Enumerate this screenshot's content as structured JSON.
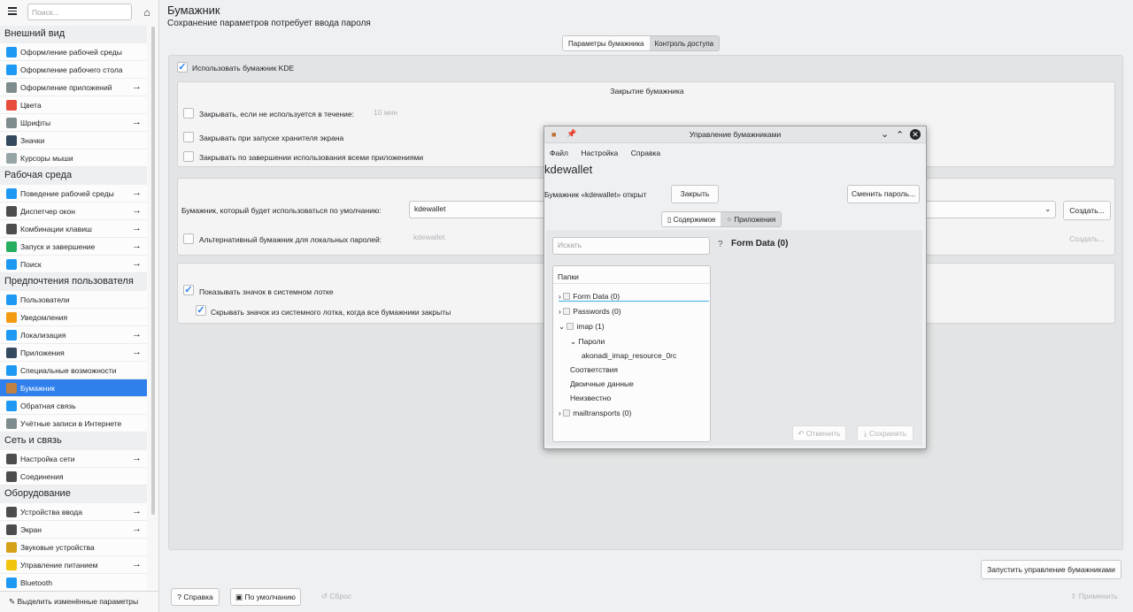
{
  "sidebar": {
    "search_placeholder": "Поиск...",
    "categories": [
      {
        "label": "Внешний вид",
        "items": [
          {
            "label": "Оформление рабочей среды",
            "arrow": false,
            "color": "#1d99f3"
          },
          {
            "label": "Оформление рабочего стола",
            "arrow": false,
            "color": "#1d99f3"
          },
          {
            "label": "Оформление приложений",
            "arrow": true,
            "color": "#7f8c8d"
          },
          {
            "label": "Цвета",
            "arrow": false,
            "color": "#e74c3c"
          },
          {
            "label": "Шрифты",
            "arrow": true,
            "color": "#7f8c8d"
          },
          {
            "label": "Значки",
            "arrow": false,
            "color": "#34495e"
          },
          {
            "label": "Курсоры мыши",
            "arrow": false,
            "color": "#95a5a6"
          }
        ]
      },
      {
        "label": "Рабочая среда",
        "items": [
          {
            "label": "Поведение рабочей среды",
            "arrow": true,
            "color": "#1d99f3"
          },
          {
            "label": "Диспетчер окон",
            "arrow": true,
            "color": "#4d4d4d"
          },
          {
            "label": "Комбинации клавиш",
            "arrow": true,
            "color": "#4d4d4d"
          },
          {
            "label": "Запуск и завершение",
            "arrow": true,
            "color": "#27ae60"
          },
          {
            "label": "Поиск",
            "arrow": true,
            "color": "#1d99f3"
          }
        ]
      },
      {
        "label": "Предпочтения пользователя",
        "items": [
          {
            "label": "Пользователи",
            "arrow": false,
            "color": "#1d99f3"
          },
          {
            "label": "Уведомления",
            "arrow": false,
            "color": "#f39c12"
          },
          {
            "label": "Локализация",
            "arrow": true,
            "color": "#1d99f3"
          },
          {
            "label": "Приложения",
            "arrow": true,
            "color": "#34495e"
          },
          {
            "label": "Специальные возможности",
            "arrow": false,
            "color": "#1d99f3"
          },
          {
            "label": "Бумажник",
            "arrow": false,
            "color": "#c08040",
            "selected": true
          },
          {
            "label": "Обратная связь",
            "arrow": false,
            "color": "#1d99f3"
          },
          {
            "label": "Учётные записи в Интернете",
            "arrow": false,
            "color": "#7f8c8d"
          }
        ]
      },
      {
        "label": "Сеть и связь",
        "items": [
          {
            "label": "Настройка сети",
            "arrow": true,
            "color": "#4d4d4d"
          },
          {
            "label": "Соединения",
            "arrow": false,
            "color": "#4d4d4d"
          }
        ]
      },
      {
        "label": "Оборудование",
        "items": [
          {
            "label": "Устройства ввода",
            "arrow": true,
            "color": "#4d4d4d"
          },
          {
            "label": "Экран",
            "arrow": true,
            "color": "#4d4d4d"
          },
          {
            "label": "Звуковые устройства",
            "arrow": false,
            "color": "#d4a017"
          },
          {
            "label": "Управление питанием",
            "arrow": true,
            "color": "#f1c40f"
          },
          {
            "label": "Bluetooth",
            "arrow": false,
            "color": "#1d99f3"
          }
        ]
      }
    ],
    "highlight_changed": "Выделить изменённые параметры"
  },
  "page": {
    "title": "Бумажник",
    "subtitle": "Сохранение параметров потребует ввода пароля",
    "tabs": [
      "Параметры бумажника",
      "Контроль доступа"
    ],
    "use_kde_wallet": "Использовать бумажник KDE",
    "close_group_title": "Закрытие бумажника",
    "close_if_unused": "Закрывать, если не используется в течение:",
    "close_minutes": "10 мин",
    "close_on_screensaver": "Закрывать при запуске хранителя экрана",
    "close_when_apps_done": "Закрывать по завершении использования всеми приложениями",
    "default_wallet_label": "Бумажник, который будет использоваться по умолчанию:",
    "default_wallet_value": "kdewallet",
    "create": "Создать...",
    "alt_local_label": "Альтернативный бумажник для локальных паролей:",
    "alt_local_value": "kdewallet",
    "show_tray": "Показывать значок в системном лотке",
    "hide_tray": "Скрывать значок из системного лотка, когда все бумажники закрыты",
    "launch_manager": "Запустить управление бумажниками",
    "help": "Справка",
    "defaults": "По умолчанию",
    "reset": "Сброс",
    "apply": "Применить"
  },
  "dialog": {
    "title": "Управление бумажниками",
    "menu": [
      "Файл",
      "Настройка",
      "Справка"
    ],
    "wallet_name": "kdewallet",
    "open_status": "Бумажник «kdewallet» открыт",
    "close_btn": "Закрыть",
    "change_password": "Сменить пароль...",
    "tabs": [
      "Содержимое",
      "Приложения"
    ],
    "search_placeholder": "Искать",
    "folders_header": "Папки",
    "tree": [
      {
        "label": "Form Data (0)",
        "indent": 0
      },
      {
        "label": "Passwords (0)",
        "indent": 0
      },
      {
        "label": "imap (1)",
        "indent": 0
      },
      {
        "label": "Пароли",
        "indent": 1
      },
      {
        "label": "akonadi_imap_resource_0rc",
        "indent": 2
      },
      {
        "label": "Соответствия",
        "indent": 1
      },
      {
        "label": "Двоичные данные",
        "indent": 1
      },
      {
        "label": "Неизвестно",
        "indent": 1
      },
      {
        "label": "mailtransports (0)",
        "indent": 0
      }
    ],
    "detail_title": "Form Data (0)",
    "undo": "Отменить",
    "save": "Сохранить"
  }
}
